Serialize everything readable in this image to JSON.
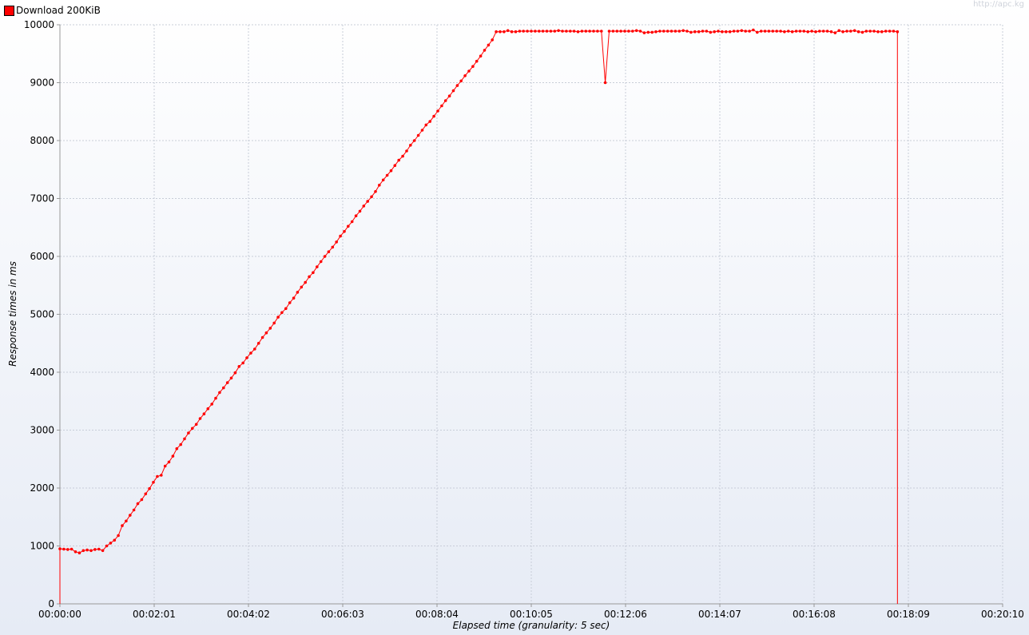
{
  "legend": {
    "label": "Download 200KiB",
    "color": "#ff0000"
  },
  "watermark": "http://apc.kg",
  "chart_data": {
    "type": "line",
    "title": "",
    "xlabel": "Elapsed time (granularity: 5 sec)",
    "ylabel": "Response times in ms",
    "ylim": [
      0,
      10000
    ],
    "y_ticks": [
      0,
      1000,
      2000,
      3000,
      4000,
      5000,
      6000,
      7000,
      8000,
      9000,
      10000
    ],
    "x_range_seconds": [
      0,
      1210
    ],
    "x_ticks": [
      {
        "t": 0,
        "label": "00:00:00"
      },
      {
        "t": 121,
        "label": "00:02:01"
      },
      {
        "t": 242,
        "label": "00:04:02"
      },
      {
        "t": 363,
        "label": "00:06:03"
      },
      {
        "t": 484,
        "label": "00:08:04"
      },
      {
        "t": 605,
        "label": "00:10:05"
      },
      {
        "t": 726,
        "label": "00:12:06"
      },
      {
        "t": 847,
        "label": "00:14:07"
      },
      {
        "t": 968,
        "label": "00:16:08"
      },
      {
        "t": 1089,
        "label": "00:18:09"
      },
      {
        "t": 1210,
        "label": "00:20:10"
      }
    ],
    "grid": true,
    "legend_position": "top-left",
    "series": [
      {
        "name": "Download 200KiB",
        "color": "#ff0000",
        "x_step_seconds": 5,
        "values": [
          950,
          945,
          940,
          945,
          900,
          880,
          920,
          930,
          920,
          940,
          945,
          920,
          1000,
          1050,
          1100,
          1180,
          1350,
          1430,
          1530,
          1620,
          1730,
          1800,
          1900,
          1990,
          2100,
          2200,
          2220,
          2380,
          2450,
          2550,
          2680,
          2750,
          2850,
          2950,
          3030,
          3100,
          3200,
          3280,
          3370,
          3450,
          3550,
          3650,
          3730,
          3820,
          3900,
          3990,
          4100,
          4160,
          4250,
          4330,
          4400,
          4500,
          4600,
          4680,
          4760,
          4850,
          4950,
          5030,
          5100,
          5200,
          5280,
          5380,
          5470,
          5550,
          5650,
          5720,
          5820,
          5910,
          6000,
          6080,
          6160,
          6250,
          6350,
          6430,
          6520,
          6600,
          6700,
          6780,
          6870,
          6950,
          7030,
          7120,
          7230,
          7320,
          7400,
          7480,
          7570,
          7660,
          7730,
          7820,
          7920,
          8000,
          8090,
          8180,
          8270,
          8330,
          8420,
          8510,
          8600,
          8690,
          8770,
          8860,
          8950,
          9030,
          9120,
          9200,
          9280,
          9370,
          9460,
          9560,
          9650,
          9740,
          9880,
          9880,
          9880,
          9900,
          9880,
          9880,
          9890,
          9890,
          9890,
          9890,
          9890,
          9890,
          9890,
          9890,
          9890,
          9890,
          9900,
          9890,
          9890,
          9890,
          9890,
          9880,
          9890,
          9890,
          9890,
          9890,
          9890,
          9890,
          9000,
          9890,
          9890,
          9890,
          9890,
          9890,
          9890,
          9890,
          9900,
          9890,
          9860,
          9870,
          9870,
          9880,
          9890,
          9890,
          9890,
          9890,
          9890,
          9890,
          9900,
          9890,
          9870,
          9880,
          9880,
          9890,
          9890,
          9870,
          9880,
          9890,
          9880,
          9880,
          9880,
          9890,
          9890,
          9900,
          9890,
          9890,
          9910,
          9870,
          9890,
          9890,
          9890,
          9890,
          9890,
          9890,
          9880,
          9890,
          9880,
          9890,
          9890,
          9890,
          9880,
          9890,
          9880,
          9890,
          9890,
          9890,
          9880,
          9860,
          9900,
          9880,
          9890,
          9890,
          9900,
          9880,
          9870,
          9890,
          9890,
          9890,
          9880,
          9880,
          9890,
          9890,
          9890,
          9880
        ]
      }
    ]
  }
}
